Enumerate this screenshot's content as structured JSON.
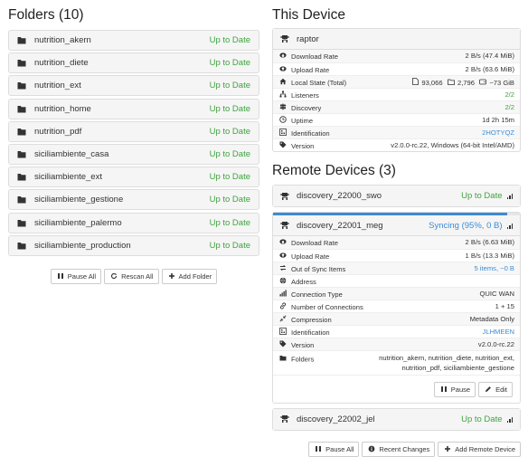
{
  "folders_section": {
    "title": "Folders (10)",
    "items": [
      {
        "name": "nutrition_akern",
        "status": "Up to Date"
      },
      {
        "name": "nutrition_diete",
        "status": "Up to Date"
      },
      {
        "name": "nutrition_ext",
        "status": "Up to Date"
      },
      {
        "name": "nutrition_home",
        "status": "Up to Date"
      },
      {
        "name": "nutrition_pdf",
        "status": "Up to Date"
      },
      {
        "name": "siciliambiente_casa",
        "status": "Up to Date"
      },
      {
        "name": "siciliambiente_ext",
        "status": "Up to Date"
      },
      {
        "name": "siciliambiente_gestione",
        "status": "Up to Date"
      },
      {
        "name": "siciliambiente_palermo",
        "status": "Up to Date"
      },
      {
        "name": "siciliambiente_production",
        "status": "Up to Date"
      }
    ],
    "buttons": {
      "pause_all": "Pause All",
      "rescan_all": "Rescan All",
      "add_folder": "Add Folder"
    }
  },
  "this_device": {
    "title": "This Device",
    "name": "raptor",
    "rows": {
      "download_rate": {
        "label": "Download Rate",
        "value": "2 B/s (47.4 MiB)"
      },
      "upload_rate": {
        "label": "Upload Rate",
        "value": "2 B/s (63.6 MiB)"
      },
      "local_state": {
        "label": "Local State (Total)",
        "files": "93,066",
        "dirs": "2,796",
        "size": "~73 GiB"
      },
      "listeners": {
        "label": "Listeners",
        "value": "2/2"
      },
      "discovery": {
        "label": "Discovery",
        "value": "2/2"
      },
      "uptime": {
        "label": "Uptime",
        "value": "1d 2h 15m"
      },
      "identification": {
        "label": "Identification",
        "value": "2HOTYQZ"
      },
      "version": {
        "label": "Version",
        "value": "v2.0.0-rc.22, Windows (64-bit Intel/AMD)"
      }
    }
  },
  "remote_devices": {
    "title": "Remote Devices (3)",
    "devices": [
      {
        "name": "discovery_22000_swo",
        "status": "Up to Date"
      },
      {
        "name": "discovery_22001_meg",
        "status": "Syncing (95%, 0 B)",
        "progress": 0.95
      },
      {
        "name": "discovery_22002_jel",
        "status": "Up to Date"
      }
    ],
    "expanded": {
      "download_rate": {
        "label": "Download Rate",
        "value": "2 B/s (6.63 MiB)"
      },
      "upload_rate": {
        "label": "Upload Rate",
        "value": "1 B/s (13.3 MiB)"
      },
      "out_of_sync": {
        "label": "Out of Sync Items",
        "value": "5 items, ~0 B"
      },
      "address": {
        "label": "Address",
        "value": ""
      },
      "connection_type": {
        "label": "Connection Type",
        "value": "QUIC WAN"
      },
      "num_connections": {
        "label": "Number of Connections",
        "value": "1 + 15"
      },
      "compression": {
        "label": "Compression",
        "value": "Metadata Only"
      },
      "identification": {
        "label": "Identification",
        "value": "JLHMEEN"
      },
      "version": {
        "label": "Version",
        "value": "v2.0.0-rc.22"
      },
      "folders": {
        "label": "Folders",
        "value_line1": "nutrition_akern, nutrition_diete, nutrition_ext,",
        "value_line2": "nutrition_pdf, siciliambiente_gestione"
      },
      "pause_label": "Pause",
      "edit_label": "Edit"
    },
    "buttons": {
      "pause_all": "Pause All",
      "recent_changes": "Recent Changes",
      "add_remote": "Add Remote Device"
    }
  }
}
